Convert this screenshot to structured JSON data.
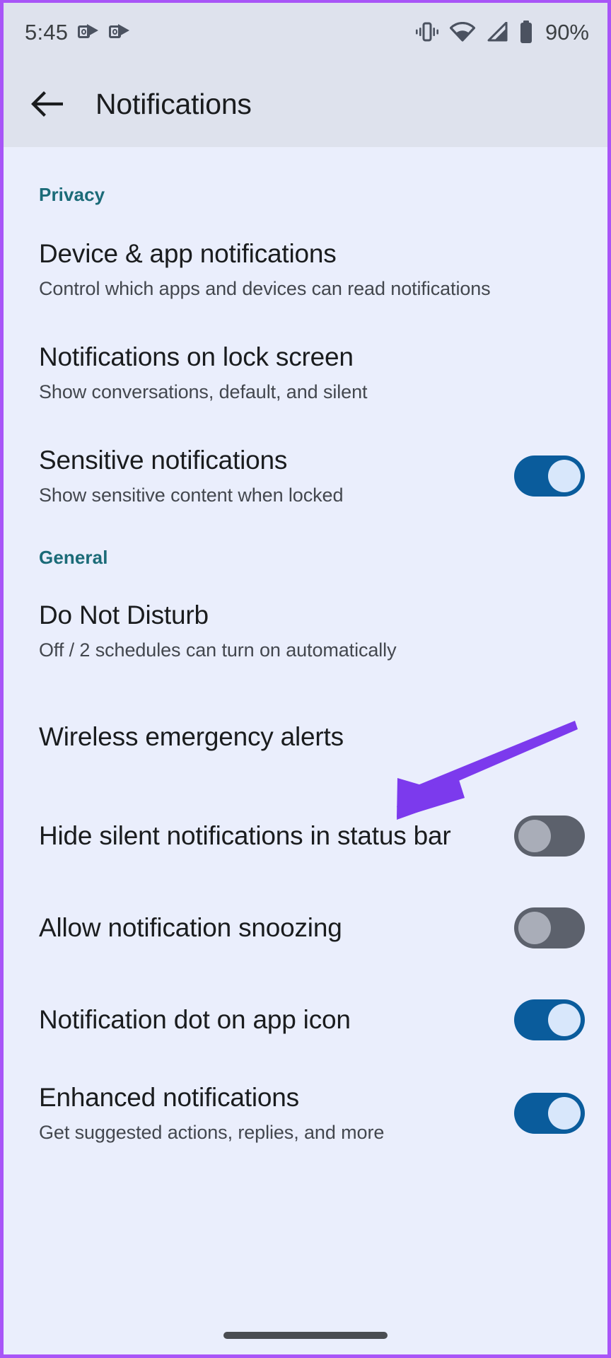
{
  "theme": {
    "frame_border": "#a855f7",
    "statusbar_bg": "#dee2ed",
    "appbar_bg": "#dee2ed",
    "content_bg": "#eaeefc",
    "section_header_color": "#1b6b78",
    "title_color": "#1a1c1e",
    "summary_color": "#43474e",
    "switch_on_track": "#0a5c9c",
    "switch_on_knob": "#d8e7fb",
    "switch_off_track": "#5c616c",
    "switch_off_knob": "#a9adb8",
    "annotation_arrow_color": "#7c3aed"
  },
  "statusbar": {
    "clock": "5:45",
    "notification_icons": [
      "outlook-icon",
      "outlook-icon"
    ],
    "status_icons": [
      "vibrate-icon",
      "wifi-icon",
      "cellular-signal-icon",
      "battery-icon"
    ],
    "battery_percent": "90%"
  },
  "appbar": {
    "back_icon": "back-arrow-icon",
    "title": "Notifications"
  },
  "sections": [
    {
      "header": "Privacy",
      "items": [
        {
          "key": "device_app_notifications",
          "title": "Device & app notifications",
          "summary": "Control which apps and devices can read notifications",
          "control": "none"
        },
        {
          "key": "notifications_on_lock_screen",
          "title": "Notifications on lock screen",
          "summary": "Show conversations, default, and silent",
          "control": "none"
        },
        {
          "key": "sensitive_notifications",
          "title": "Sensitive notifications",
          "summary": "Show sensitive content when locked",
          "control": "switch",
          "switch_state": "on"
        }
      ]
    },
    {
      "header": "General",
      "items": [
        {
          "key": "do_not_disturb",
          "title": "Do Not Disturb",
          "summary": "Off / 2 schedules can turn on automatically",
          "control": "none"
        },
        {
          "key": "wireless_emergency_alerts",
          "title": "Wireless emergency alerts",
          "summary": "",
          "control": "none"
        },
        {
          "key": "hide_silent_notifications_in_status_bar",
          "title": "Hide silent notifications in status bar",
          "summary": "",
          "control": "switch",
          "switch_state": "off"
        },
        {
          "key": "allow_notification_snoozing",
          "title": "Allow notification snoozing",
          "summary": "",
          "control": "switch",
          "switch_state": "off"
        },
        {
          "key": "notification_dot_on_app_icon",
          "title": "Notification dot on app icon",
          "summary": "",
          "control": "switch",
          "switch_state": "on"
        },
        {
          "key": "enhanced_notifications",
          "title": "Enhanced notifications",
          "summary": "Get suggested actions, replies, and more",
          "control": "switch",
          "switch_state": "on"
        }
      ]
    }
  ],
  "annotation": {
    "type": "arrow",
    "points_to": "do_not_disturb",
    "color": "#7c3aed"
  },
  "navigation": {
    "home_indicator": "home-indicator"
  }
}
